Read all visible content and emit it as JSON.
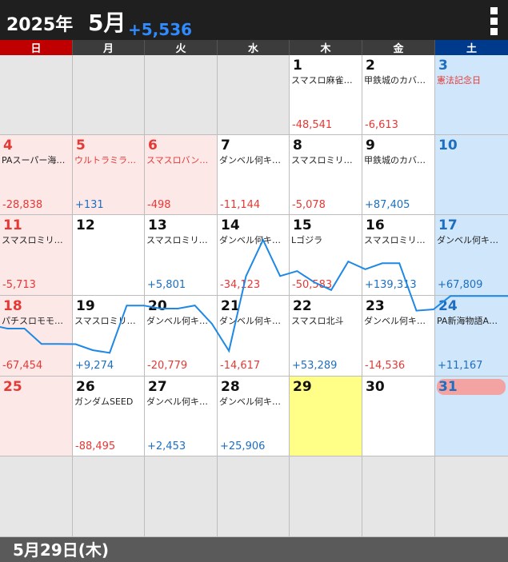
{
  "header": {
    "year": "2025年",
    "month": "5月",
    "total": "+5,536",
    "menu_icon": "more-vert-icon"
  },
  "weekdays": [
    "日",
    "月",
    "火",
    "水",
    "木",
    "金",
    "土"
  ],
  "weeks": [
    [
      null,
      null,
      null,
      null,
      {
        "day": "1",
        "label": "スマスロ麻雀…",
        "value": "-48,541",
        "sign": "neg"
      },
      {
        "day": "2",
        "label": "甲鉄城のカバ…",
        "value": "-6,613",
        "sign": "neg"
      },
      {
        "day": "3",
        "label": "憲法記念日",
        "value": "",
        "sign": "",
        "holiday": true
      }
    ],
    [
      {
        "day": "4",
        "label": "PAスーパー海…",
        "value": "-28,838",
        "sign": "neg"
      },
      {
        "day": "5",
        "label": "ウルトラミラ…",
        "value": "+131",
        "sign": "pos",
        "holiday": true
      },
      {
        "day": "6",
        "label": "スマスロバン…",
        "value": "-498",
        "sign": "neg",
        "holiday": true
      },
      {
        "day": "7",
        "label": "ダンベル何キ…",
        "value": "-11,144",
        "sign": "neg"
      },
      {
        "day": "8",
        "label": "スマスロミリ…",
        "value": "-5,078",
        "sign": "neg"
      },
      {
        "day": "9",
        "label": "甲鉄城のカバ…",
        "value": "+87,405",
        "sign": "pos"
      },
      {
        "day": "10",
        "label": "",
        "value": "",
        "sign": ""
      }
    ],
    [
      {
        "day": "11",
        "label": "スマスロミリ…",
        "value": "-5,713",
        "sign": "neg"
      },
      {
        "day": "12",
        "label": "",
        "value": "",
        "sign": ""
      },
      {
        "day": "13",
        "label": "スマスロミリ…",
        "value": "+5,801",
        "sign": "pos"
      },
      {
        "day": "14",
        "label": "ダンベル何キ…",
        "value": "-34,123",
        "sign": "neg"
      },
      {
        "day": "15",
        "label": "Lゴジラ",
        "value": "-50,583",
        "sign": "neg"
      },
      {
        "day": "16",
        "label": "スマスロミリ…",
        "value": "+139,313",
        "sign": "pos"
      },
      {
        "day": "17",
        "label": "ダンベル何キ…",
        "value": "+67,809",
        "sign": "pos"
      }
    ],
    [
      {
        "day": "18",
        "label": "パチスロモモ…",
        "value": "-67,454",
        "sign": "neg"
      },
      {
        "day": "19",
        "label": "スマスロミリ…",
        "value": "+9,274",
        "sign": "pos"
      },
      {
        "day": "20",
        "label": "ダンベル何キ…",
        "value": "-20,779",
        "sign": "neg"
      },
      {
        "day": "21",
        "label": "ダンベル何キ…",
        "value": "-14,617",
        "sign": "neg"
      },
      {
        "day": "22",
        "label": "スマスロ北斗",
        "value": "+53,289",
        "sign": "pos"
      },
      {
        "day": "23",
        "label": "ダンベル何キ…",
        "value": "-14,536",
        "sign": "neg"
      },
      {
        "day": "24",
        "label": "PA新海物語A…",
        "value": "+11,167",
        "sign": "pos"
      }
    ],
    [
      {
        "day": "25",
        "label": "",
        "value": "",
        "sign": ""
      },
      {
        "day": "26",
        "label": "ガンダムSEED",
        "value": "-88,495",
        "sign": "neg"
      },
      {
        "day": "27",
        "label": "ダンベル何キ…",
        "value": "+2,453",
        "sign": "pos"
      },
      {
        "day": "28",
        "label": "ダンベル何キ…",
        "value": "+25,906",
        "sign": "pos"
      },
      {
        "day": "29",
        "label": "",
        "value": "",
        "sign": "",
        "selected": true
      },
      {
        "day": "30",
        "label": "",
        "value": "",
        "sign": ""
      },
      {
        "day": "31",
        "label": "",
        "value": "",
        "sign": "",
        "today": true
      }
    ],
    [
      null,
      null,
      null,
      null,
      null,
      null,
      null
    ]
  ],
  "trend_line": {
    "color": "#1e88e5",
    "days": [
      1,
      2,
      3,
      4,
      5,
      6,
      7,
      8,
      9,
      10,
      11,
      12,
      13,
      14,
      15,
      16,
      17,
      18,
      19,
      20,
      21,
      22,
      23,
      24,
      25,
      26,
      27,
      28,
      29,
      30,
      31
    ],
    "cumulative": [
      -48541,
      -55154,
      -55154,
      -83992,
      -83861,
      -84359,
      -95503,
      -100581,
      -12176,
      -12176,
      -17889,
      -17889,
      -12088,
      -46211,
      -96794,
      42519,
      110328,
      42874,
      52148,
      31369,
      16752,
      70041,
      55505,
      66672,
      66672,
      -21823,
      -19370,
      5536,
      5536,
      5536,
      5536
    ]
  },
  "footer": {
    "selected_date": "5月29日(木)"
  }
}
